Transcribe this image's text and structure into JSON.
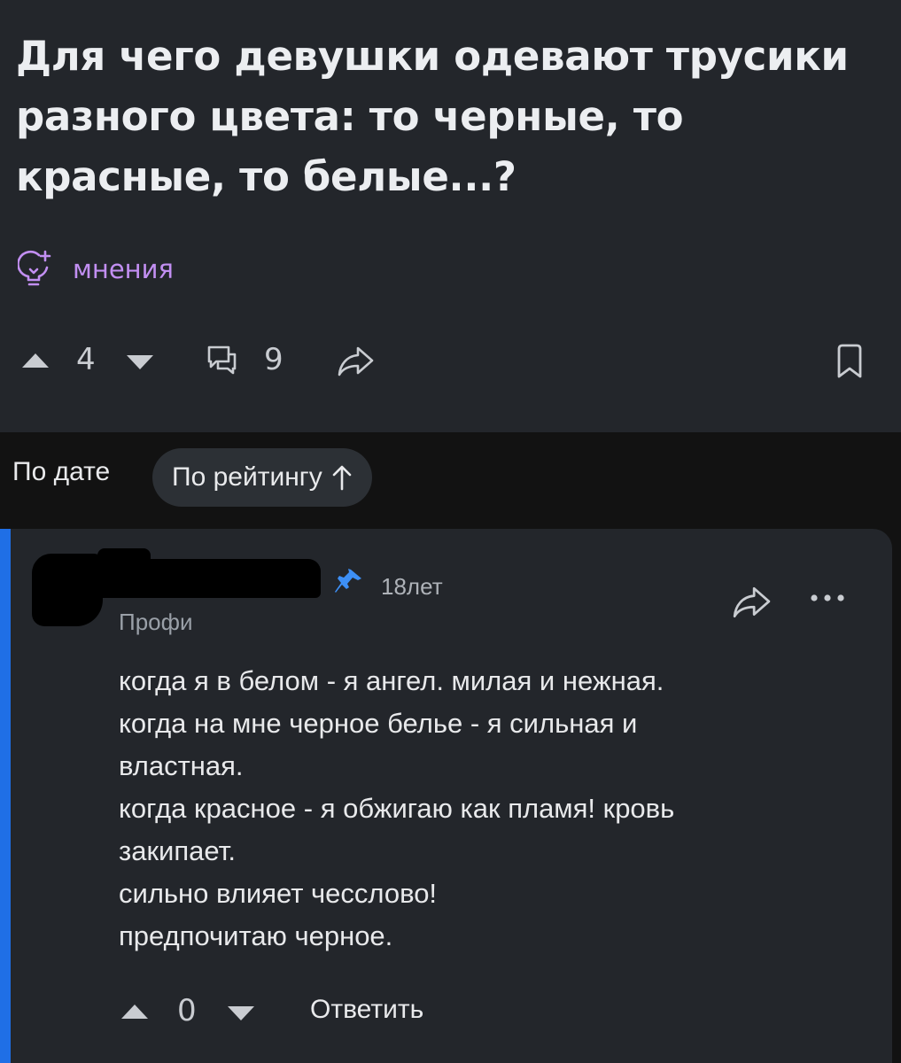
{
  "question": {
    "title": "Для чего девушки одевают трусики разного цвета: то черные, то красные, то белые...?",
    "category": "мнения",
    "votes": "4",
    "comments": "9"
  },
  "sort": {
    "by_date": "По дате",
    "by_rating": "По рейтингу"
  },
  "answer": {
    "age": "18лет",
    "role": "Профи",
    "lines": [
      "когда я в белом - я ангел. милая и нежная.",
      "когда на мне черное белье - я сильная и",
      "властная.",
      "когда красное - я обжигаю как пламя! кровь",
      "закипает.",
      "сильно влияет чесслово!",
      "предпочитаю черное."
    ],
    "votes": "0",
    "reply": "Ответить"
  },
  "colors": {
    "accent": "#1f6fe6",
    "category": "#c28ff2",
    "card_bg": "#23262b",
    "page_bg": "#121212"
  }
}
